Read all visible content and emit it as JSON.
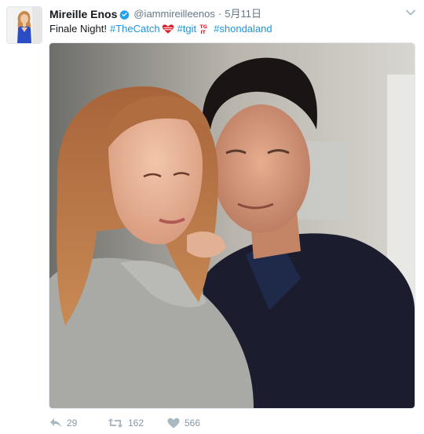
{
  "tweet": {
    "display_name": "Mireille Enos",
    "verified": true,
    "handle": "@iammireilleenos",
    "separator": "·",
    "timestamp": "5月11日",
    "text_prefix": "Finale Night!",
    "hashtags": [
      "#TheCatch",
      "#tgit",
      "#shondaland"
    ],
    "emojis": [
      "heart-emoji",
      "tgit-emoji"
    ]
  },
  "media": {
    "type": "photo",
    "description_icon": "photo-image"
  },
  "actions": {
    "reply_count": "29",
    "retweet_count": "162",
    "like_count": "566"
  },
  "icons": {
    "verified": "verified-badge-icon",
    "caret": "chevron-down-icon",
    "reply": "reply-icon",
    "retweet": "retweet-icon",
    "like": "heart-icon"
  },
  "colors": {
    "link": "#1b95e0",
    "verified": "#1da1f2",
    "muted": "#8899a6",
    "text": "#14171a"
  }
}
